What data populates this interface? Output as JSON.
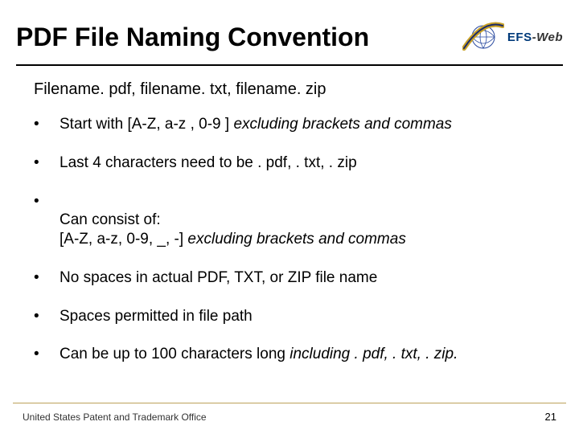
{
  "title": "PDF File Naming Convention",
  "logo": {
    "efs": "EFS",
    "web": "-Web"
  },
  "lead": "Filename. pdf, filename. txt, filename. zip",
  "bullets": [
    {
      "text": "Start with [A-Z, a-z , 0-9 ] ",
      "italic": "excluding brackets and commas"
    },
    {
      "text": "Last 4 characters need to be . pdf, . txt, . zip"
    },
    {
      "text": "Can consist of:\n[A-Z, a-z, 0-9, _, -] ",
      "italic": "excluding brackets and commas"
    },
    {
      "text": "No spaces in actual PDF, TXT, or ZIP file name"
    },
    {
      "text": "Spaces permitted in file path"
    },
    {
      "text": "Can be up to 100 characters long ",
      "italic": "including . pdf, . txt, . zip."
    }
  ],
  "footer": "United States Patent and Trademark Office",
  "page": "21"
}
